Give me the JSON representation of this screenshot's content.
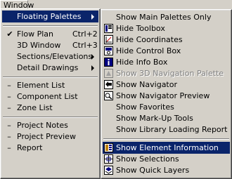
{
  "menubar": {
    "title": "Window"
  },
  "main_menu": {
    "items": [
      {
        "label": "Floating Palettes",
        "selected": true,
        "submenu": true
      },
      {
        "label": "Flow Plan",
        "shortcut": "Ctrl+2",
        "checked": true
      },
      {
        "label": "3D Window",
        "shortcut": "Ctrl+3"
      },
      {
        "label": "Sections/Elevations",
        "submenu": true
      },
      {
        "label": "Detail Drawings",
        "submenu": true
      },
      {
        "label": "Element List"
      },
      {
        "label": "Component List"
      },
      {
        "label": "Zone List"
      },
      {
        "label": "Project Notes"
      },
      {
        "label": "Project Preview"
      },
      {
        "label": "Report"
      }
    ]
  },
  "submenu": {
    "items": [
      {
        "label": "Show Main Palettes Only"
      },
      {
        "label": "Hide Toolbox",
        "icon": "toolbox-icon"
      },
      {
        "label": "Hide Coordinates",
        "icon": "coordinates-icon"
      },
      {
        "label": "Hide Control Box",
        "icon": "control-box-icon"
      },
      {
        "label": "Hide Info Box",
        "icon": "info-box-icon"
      },
      {
        "label": "Show 3D Navigation Palette",
        "disabled": true,
        "icon": "navigation-3d-icon"
      },
      {
        "label": "Show Navigator",
        "icon": "navigator-icon"
      },
      {
        "label": "Show Navigator Preview",
        "icon": "navigator-preview-icon"
      },
      {
        "label": "Show Favorites"
      },
      {
        "label": "Show Mark-Up Tools"
      },
      {
        "label": "Show Library Loading Report"
      },
      {
        "label": "Show Element Information",
        "selected": true,
        "icon": "element-info-icon"
      },
      {
        "label": "Show Selections",
        "icon": "selections-icon"
      },
      {
        "label": "Show Quick Layers",
        "icon": "quick-layers-icon"
      }
    ]
  }
}
